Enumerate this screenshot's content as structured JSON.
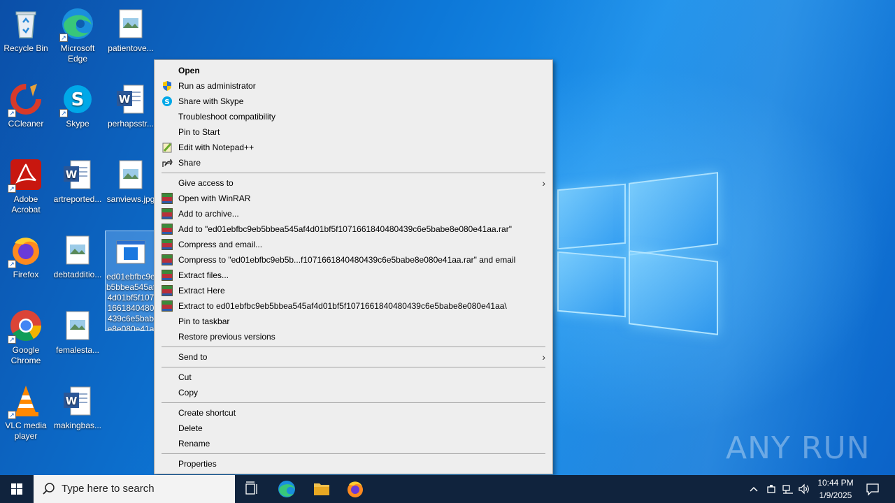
{
  "desktop": {
    "icons": [
      {
        "label": "Recycle Bin"
      },
      {
        "label": "Microsoft Edge"
      },
      {
        "label": "patientove..."
      },
      {
        "label": "CCleaner"
      },
      {
        "label": "Skype"
      },
      {
        "label": "perhapsstr..."
      },
      {
        "label": "Adobe Acrobat"
      },
      {
        "label": "artreported..."
      },
      {
        "label": "sanviews.jpg"
      },
      {
        "label": "Firefox"
      },
      {
        "label": "debtadditio..."
      },
      {
        "label": "ed01ebfbc9eb5bbea545af4d01bf5f1071661840480439c6e5babe8e080e41aa.exe"
      },
      {
        "label": "Google Chrome"
      },
      {
        "label": "femalesta..."
      },
      {
        "label": "VLC media player"
      },
      {
        "label": "makingbas..."
      }
    ],
    "watermark": "ANY RUN"
  },
  "context_menu": {
    "items": [
      {
        "label": "Open"
      },
      {
        "label": "Run as administrator"
      },
      {
        "label": "Share with Skype"
      },
      {
        "label": "Troubleshoot compatibility"
      },
      {
        "label": "Pin to Start"
      },
      {
        "label": "Edit with Notepad++"
      },
      {
        "label": "Share"
      },
      {
        "label": "Give access to"
      },
      {
        "label": "Open with WinRAR"
      },
      {
        "label": "Add to archive..."
      },
      {
        "label": "Add to \"ed01ebfbc9eb5bbea545af4d01bf5f1071661840480439c6e5babe8e080e41aa.rar\""
      },
      {
        "label": "Compress and email..."
      },
      {
        "label": "Compress to \"ed01ebfbc9eb5b...f1071661840480439c6e5babe8e080e41aa.rar\" and email"
      },
      {
        "label": "Extract files..."
      },
      {
        "label": "Extract Here"
      },
      {
        "label": "Extract to ed01ebfbc9eb5bbea545af4d01bf5f1071661840480439c6e5babe8e080e41aa\\"
      },
      {
        "label": "Pin to taskbar"
      },
      {
        "label": "Restore previous versions"
      },
      {
        "label": "Send to"
      },
      {
        "label": "Cut"
      },
      {
        "label": "Copy"
      },
      {
        "label": "Create shortcut"
      },
      {
        "label": "Delete"
      },
      {
        "label": "Rename"
      },
      {
        "label": "Properties"
      }
    ]
  },
  "taskbar": {
    "search_placeholder": "Type here to search",
    "time": "10:44 PM",
    "date": "1/9/2025"
  }
}
